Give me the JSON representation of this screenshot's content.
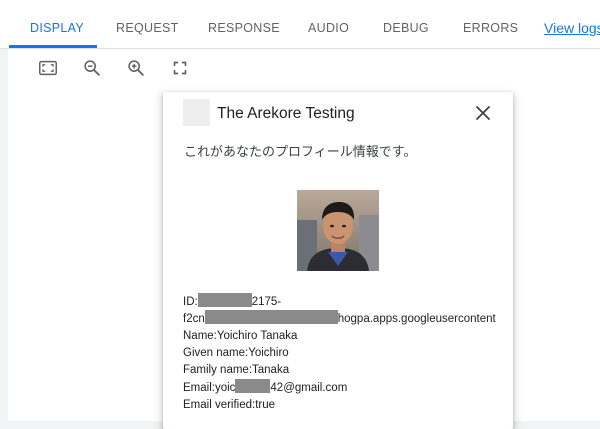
{
  "tabs": [
    {
      "label": "DISPLAY",
      "active": true
    },
    {
      "label": "REQUEST",
      "active": false
    },
    {
      "label": "RESPONSE",
      "active": false
    },
    {
      "label": "AUDIO",
      "active": false
    },
    {
      "label": "DEBUG",
      "active": false
    },
    {
      "label": "ERRORS",
      "active": false
    }
  ],
  "view_logs_label": "View logs",
  "toolbar": {
    "icons": [
      "fit-screen-icon",
      "zoom-out-icon",
      "zoom-in-icon",
      "fullscreen-icon"
    ]
  },
  "card": {
    "title": "The Arekore Testing",
    "subtitle": "これがあなたのプロフィール情報です。",
    "id_prefix": "ID:",
    "id_suffix": "2175-",
    "id_line2_prefix": "f2cn",
    "id_line2_suffix": "hogpa.apps.googleusercontent",
    "name_line": "Name:Yoichiro Tanaka",
    "given_name_line": "Given name:Yoichiro",
    "family_name_line": "Family name:Tanaka",
    "email_prefix": "Email:yoic",
    "email_suffix": "42@gmail.com",
    "email_verified_line": "Email verified:true"
  },
  "colors": {
    "accent": "#1a73e8",
    "tab_text": "#5f6368",
    "background": "#f1f3f4",
    "redaction": "#8a8a8a"
  }
}
